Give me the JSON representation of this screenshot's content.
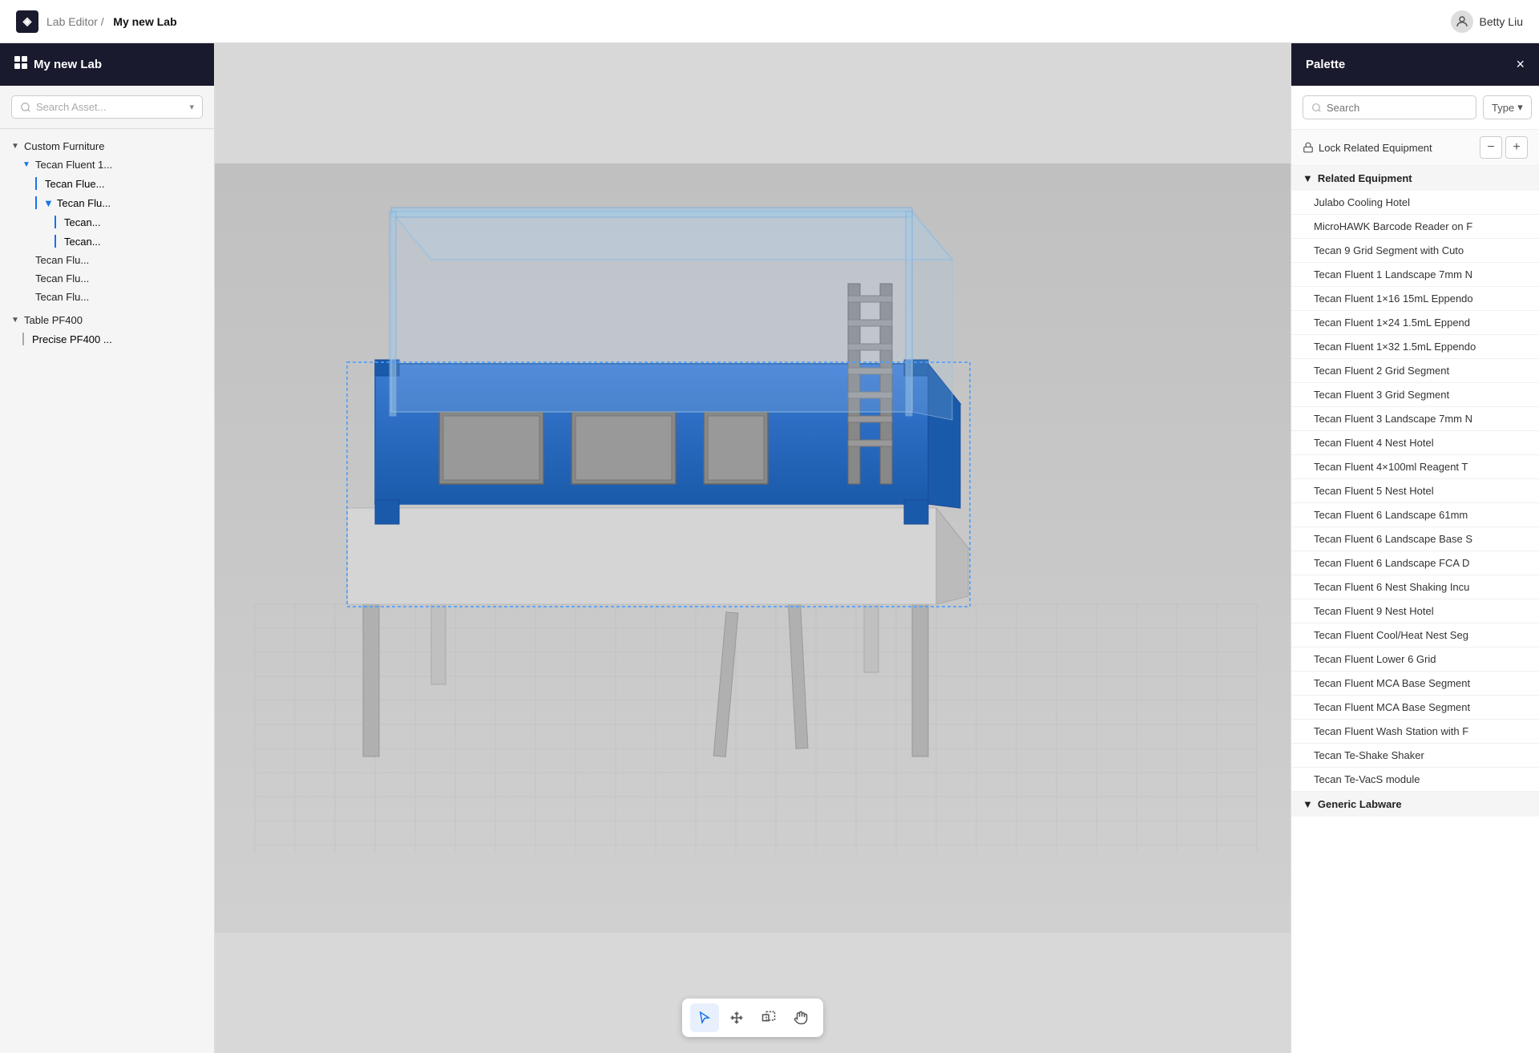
{
  "topBar": {
    "brandIcon": "◈",
    "breadcrumb": {
      "prefix": "Lab Editor /",
      "current": "My new Lab"
    },
    "user": {
      "name": "Betty Liu",
      "icon": "👤"
    }
  },
  "sidebar": {
    "title": "My new Lab",
    "titleIcon": "⊞",
    "search": {
      "placeholder": "Search Asset...",
      "value": ""
    },
    "tree": [
      {
        "id": "custom-furniture",
        "label": "Custom Furniture",
        "level": 0,
        "arrow": "▼",
        "type": "category"
      },
      {
        "id": "tecan-fluent-1",
        "label": "Tecan Fluent 1...",
        "level": 1,
        "arrow": "▼",
        "type": "item"
      },
      {
        "id": "tecan-flue",
        "label": "Tecan Flue...",
        "level": 2,
        "arrow": "",
        "type": "leaf"
      },
      {
        "id": "tecan-flu-2",
        "label": "Tecan Flu...",
        "level": 2,
        "arrow": "▼",
        "type": "item"
      },
      {
        "id": "tecan-1",
        "label": "Tecan...",
        "level": 3,
        "arrow": "",
        "type": "leaf"
      },
      {
        "id": "tecan-2",
        "label": "Tecan...",
        "level": 3,
        "arrow": "",
        "type": "leaf"
      },
      {
        "id": "tecan-flu-3",
        "label": "Tecan Flu...",
        "level": 2,
        "arrow": "",
        "type": "leaf"
      },
      {
        "id": "tecan-flu-4",
        "label": "Tecan Flu...",
        "level": 2,
        "arrow": "",
        "type": "leaf"
      },
      {
        "id": "tecan-flu-5",
        "label": "Tecan Flu...",
        "level": 2,
        "arrow": "",
        "type": "leaf"
      },
      {
        "id": "table-pf400",
        "label": "Table PF400",
        "level": 0,
        "arrow": "▼",
        "type": "category"
      },
      {
        "id": "precise-pf400",
        "label": "Precise PF400 ...",
        "level": 1,
        "arrow": "",
        "type": "leaf"
      }
    ]
  },
  "viewport": {
    "tools": [
      {
        "id": "select",
        "icon": "↖",
        "label": "Select",
        "active": true
      },
      {
        "id": "move",
        "icon": "✛",
        "label": "Move",
        "active": false
      },
      {
        "id": "multi-select",
        "icon": "⊹",
        "label": "Multi Select",
        "active": false
      },
      {
        "id": "pan",
        "icon": "✋",
        "label": "Pan",
        "active": false
      }
    ]
  },
  "palette": {
    "title": "Palette",
    "closeIcon": "×",
    "search": {
      "placeholder": "Search",
      "value": ""
    },
    "typeFilter": {
      "label": "Type",
      "icon": "▾"
    },
    "lockBar": {
      "lockIcon": "🔒",
      "label": "Lock Related Equipment",
      "minusLabel": "−",
      "plusLabel": "+"
    },
    "sections": [
      {
        "id": "related-equipment",
        "label": "Related Equipment",
        "arrow": "▼",
        "items": [
          "Julabo Cooling Hotel",
          "MicroHAWK Barcode Reader on F",
          "Tecan 9 Grid Segment with Cuto",
          "Tecan Fluent 1 Landscape 7mm N",
          "Tecan Fluent 1×16 15mL Eppendo",
          "Tecan Fluent 1×24 1.5mL Eppend",
          "Tecan Fluent 1×32 1.5mL Eppendo",
          "Tecan Fluent 2 Grid Segment",
          "Tecan Fluent 3 Grid Segment",
          "Tecan Fluent 3 Landscape 7mm N",
          "Tecan Fluent 4 Nest Hotel",
          "Tecan Fluent 4×100ml Reagent T",
          "Tecan Fluent 5 Nest Hotel",
          "Tecan Fluent 6 Landscape 61mm",
          "Tecan Fluent 6 Landscape Base S",
          "Tecan Fluent 6 Landscape FCA D",
          "Tecan Fluent 6 Nest Shaking Incu",
          "Tecan Fluent 9 Nest Hotel",
          "Tecan Fluent Cool/Heat Nest Seg",
          "Tecan Fluent Lower 6 Grid",
          "Tecan Fluent MCA Base Segment",
          "Tecan Fluent MCA Base Segment",
          "Tecan Fluent Wash Station with F",
          "Tecan Te-Shake Shaker",
          "Tecan Te-VacS module"
        ]
      },
      {
        "id": "generic-labware",
        "label": "Generic Labware",
        "arrow": "▼",
        "items": []
      }
    ]
  }
}
